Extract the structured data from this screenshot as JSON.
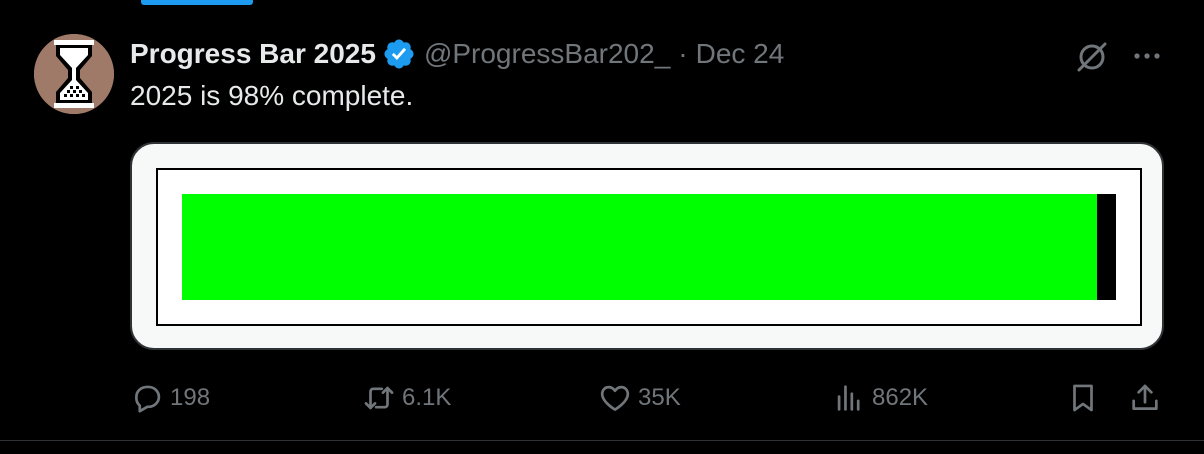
{
  "tweet": {
    "display_name": "Progress Bar 2025",
    "handle": "@ProgressBar202_",
    "separator": "·",
    "date": "Dec 24",
    "text": "2025 is 98% complete.",
    "progress_fraction": 0.98,
    "icons": {
      "avatar": "hourglass-icon",
      "verified": "verified-badge-icon",
      "grok": "grok-icon",
      "more": "more-icon"
    }
  },
  "actions": {
    "reply_count": "198",
    "retweet_count": "6.1K",
    "like_count": "35K",
    "views_count": "862K",
    "icons": [
      "reply-icon",
      "retweet-icon",
      "like-icon",
      "views-icon",
      "bookmark-icon",
      "share-icon"
    ]
  },
  "colors": {
    "background": "#000000",
    "accent_blue": "#1d9bf0",
    "text_primary": "#e7e9ea",
    "text_secondary": "#71767b",
    "progress_fill": "#00ff00",
    "progress_empty": "#000000",
    "card_background": "#f7f9f9"
  }
}
